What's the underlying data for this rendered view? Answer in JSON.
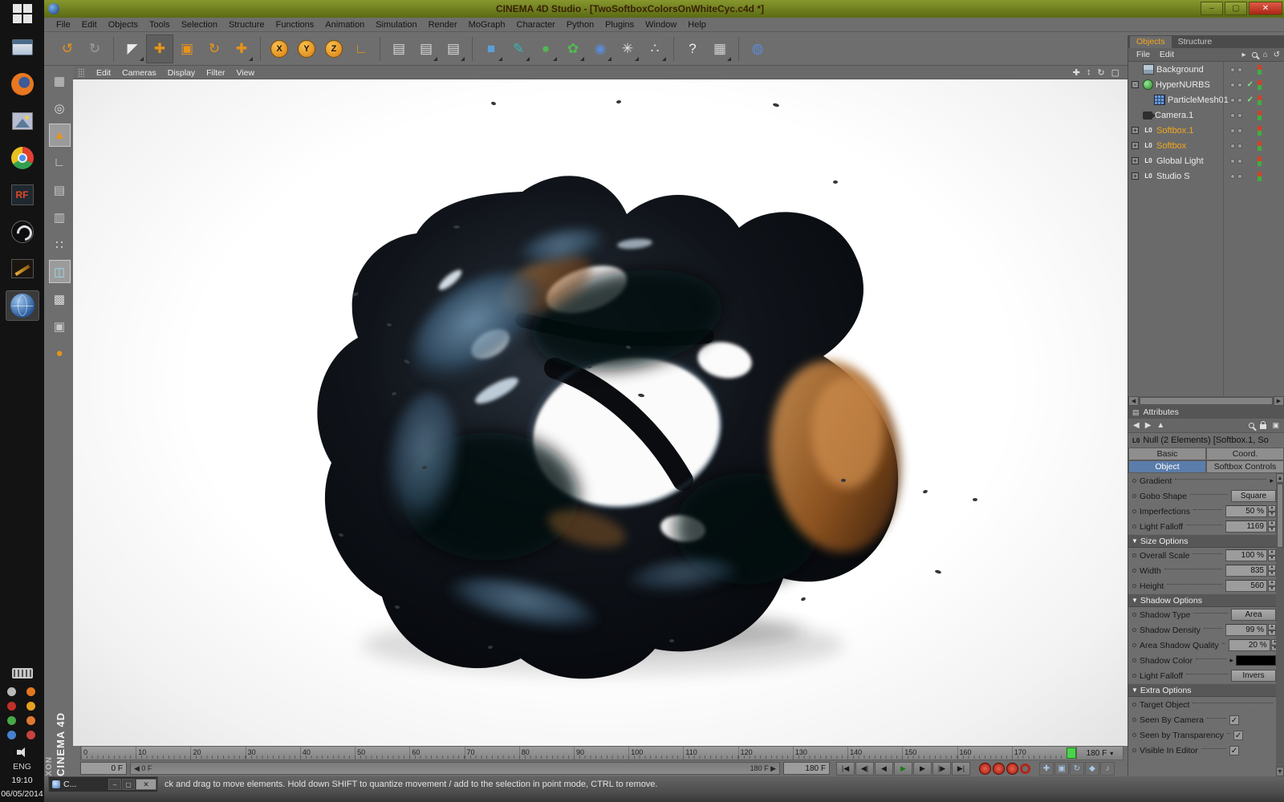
{
  "window": {
    "title": "CINEMA 4D Studio - [TwoSoftboxColorsOnWhiteCyc.c4d *]",
    "controls": {
      "minimize": "–",
      "maximize": "▢",
      "close": "✕"
    }
  },
  "taskbar": {
    "language": "ENG",
    "time": "19:10",
    "date": "06/05/2014",
    "apps": [
      {
        "name": "file-explorer-icon"
      },
      {
        "name": "firefox-icon"
      },
      {
        "name": "image-viewer-icon"
      },
      {
        "name": "chrome-icon"
      },
      {
        "name": "rf-app-icon",
        "label": "RF"
      },
      {
        "name": "obs-studio-icon"
      },
      {
        "name": "paint-app-icon"
      },
      {
        "name": "globe-app-icon",
        "active": true
      }
    ],
    "tray": [
      {
        "name": "tray-icon-1",
        "color": "#b8b8b8"
      },
      {
        "name": "tray-icon-2",
        "color": "#e07820"
      },
      {
        "name": "tray-icon-3",
        "color": "#c03028"
      },
      {
        "name": "tray-icon-4",
        "color": "#e8a020"
      },
      {
        "name": "tray-icon-5",
        "color": "#48a848"
      },
      {
        "name": "tray-icon-6",
        "color": "#e07830"
      },
      {
        "name": "tray-icon-7",
        "color": "#4880d0"
      },
      {
        "name": "tray-icon-8",
        "color": "#c84040"
      }
    ]
  },
  "menubar": {
    "items": [
      "File",
      "Edit",
      "Objects",
      "Tools",
      "Selection",
      "Structure",
      "Functions",
      "Animation",
      "Simulation",
      "Render",
      "MoGraph",
      "Character",
      "Python",
      "Plugins",
      "Window",
      "Help"
    ]
  },
  "toolbar": {
    "buttons": [
      {
        "name": "undo-button",
        "glyph": "↺",
        "color": "#e8941a"
      },
      {
        "name": "redo-button",
        "glyph": "↻",
        "color": "#9d9d9d"
      },
      {
        "name": "live-selection-tool",
        "glyph": "◤",
        "color": "#ececec",
        "sep": true,
        "corner": true
      },
      {
        "name": "move-tool",
        "glyph": "✚",
        "color": "#e8941a",
        "active": true
      },
      {
        "name": "scale-tool",
        "glyph": "▣",
        "color": "#e8941a"
      },
      {
        "name": "rotate-tool",
        "glyph": "↻",
        "color": "#e8941a"
      },
      {
        "name": "last-used-tool",
        "glyph": "✚",
        "color": "#e8941a",
        "corner": true
      },
      {
        "name": "x-axis-lock",
        "letter": "X",
        "sep": true
      },
      {
        "name": "y-axis-lock",
        "letter": "Y"
      },
      {
        "name": "z-axis-lock",
        "letter": "Z"
      },
      {
        "name": "coordinate-system-toggle",
        "glyph": "∟",
        "color": "#e8941a"
      },
      {
        "name": "render-view-button",
        "glyph": "▤",
        "color": "#d8d8d8",
        "sep": true
      },
      {
        "name": "render-picture-viewer-button",
        "glyph": "▤",
        "color": "#d8d8d8",
        "corner": true
      },
      {
        "name": "render-settings-button",
        "glyph": "▤",
        "color": "#d8d8d8",
        "corner": true
      },
      {
        "name": "add-cube-button",
        "glyph": "■",
        "color": "#5aa0d8",
        "sep": true,
        "corner": true
      },
      {
        "name": "add-spline-button",
        "glyph": "✎",
        "color": "#3ab4b4",
        "corner": true
      },
      {
        "name": "add-subdivision-button",
        "glyph": "●",
        "color": "#52b852",
        "corner": true
      },
      {
        "name": "add-array-button",
        "glyph": "✿",
        "color": "#52b852",
        "corner": true
      },
      {
        "name": "add-metaball-button",
        "glyph": "◉",
        "color": "#5a8ad8",
        "corner": true
      },
      {
        "name": "add-particles-button",
        "glyph": "✳",
        "color": "#e4e4e4",
        "corner": true
      },
      {
        "name": "add-physics-button",
        "glyph": "∴",
        "color": "#e4e4e4",
        "corner": true
      },
      {
        "name": "help-button",
        "glyph": "?",
        "color": "#ececec",
        "sep": true
      },
      {
        "name": "snap-settings-button",
        "glyph": "▦",
        "color": "#d0d0d0",
        "corner": true
      },
      {
        "name": "online-help-button",
        "glyph": "◍",
        "color": "#5a8ad8",
        "sep": true
      }
    ]
  },
  "palette": {
    "buttons": [
      {
        "name": "make-editable-button",
        "glyph": "▦",
        "color": "#cfcfcf"
      },
      {
        "name": "model-mode-button",
        "glyph": "◎",
        "color": "#dcdcdc"
      },
      {
        "name": "texture-mode-button",
        "glyph": "▲",
        "color": "#e8941a",
        "active": true
      },
      {
        "name": "axis-mode-button",
        "glyph": "∟",
        "color": "#dcdcdc"
      },
      {
        "name": "uv-mode-button",
        "glyph": "▤",
        "color": "#c8c8c8"
      },
      {
        "name": "workplane-mode-button",
        "glyph": "▥",
        "color": "#c8c8c8"
      },
      {
        "name": "points-mode-button",
        "glyph": "∷",
        "color": "#dcdcdc"
      },
      {
        "name": "edges-mode-button",
        "glyph": "◫",
        "color": "#9ad8e8",
        "active": true
      },
      {
        "name": "polygons-mode-button",
        "glyph": "▩",
        "color": "#dcdcdc"
      },
      {
        "name": "snap-mode-button",
        "glyph": "▣",
        "color": "#c8c8c8"
      },
      {
        "name": "viewport-filter-button",
        "glyph": "●",
        "color": "#e8941a"
      }
    ]
  },
  "viewport": {
    "menu": [
      "Edit",
      "Cameras",
      "Display",
      "Filter",
      "View"
    ],
    "nav": [
      {
        "name": "pan-view-icon",
        "glyph": "✚"
      },
      {
        "name": "zoom-view-icon",
        "glyph": "↕"
      },
      {
        "name": "rotate-view-icon",
        "glyph": "↻"
      },
      {
        "name": "toggle-view-icon",
        "glyph": "▢"
      }
    ]
  },
  "objects_panel": {
    "tabs": [
      {
        "label": "Objects"
      },
      {
        "label": "Structure"
      }
    ],
    "menu": [
      "File",
      "Edit"
    ],
    "header_icons": [
      {
        "name": "expand-arrow-icon",
        "glyph": "▸"
      },
      {
        "name": "search-icon",
        "css": "mini-mag"
      },
      {
        "name": "home-icon",
        "glyph": "⌂"
      },
      {
        "name": "refresh-icon",
        "glyph": "↺"
      }
    ],
    "items": [
      {
        "name": "Background",
        "icon": "background-icon",
        "indent": 0
      },
      {
        "name": "HyperNURBS",
        "icon": "hypernurbs-icon",
        "indent": 0,
        "expander": "-",
        "check": true
      },
      {
        "name": "ParticleMesh01",
        "icon": "mesh-icon",
        "indent": 1,
        "check": true
      },
      {
        "name": "Camera.1",
        "icon": "camera-icon",
        "indent": 0
      },
      {
        "name": "Softbox.1",
        "icon": "null-object-icon",
        "indent": 0,
        "expander": "+",
        "selected": true
      },
      {
        "name": "Softbox",
        "icon": "null-object-icon",
        "indent": 0,
        "expander": "+",
        "selected": true
      },
      {
        "name": "Global Light",
        "icon": "null-object-icon",
        "indent": 0,
        "expander": "+"
      },
      {
        "name": "Studio S",
        "icon": "null-object-icon",
        "indent": 0,
        "expander": "+"
      }
    ]
  },
  "attributes_panel": {
    "header": "Attributes",
    "object_title": "Null (2 Elements) [Softbox.1, So",
    "nav": [
      {
        "name": "back-icon",
        "glyph": "◀"
      },
      {
        "name": "forward-icon",
        "glyph": "▶"
      },
      {
        "name": "up-icon",
        "glyph": "▲"
      }
    ],
    "tabs": [
      {
        "label": "Basic"
      },
      {
        "label": "Coord."
      },
      {
        "label": "Object",
        "active": true
      },
      {
        "label": "Softbox Controls"
      }
    ],
    "rows": [
      {
        "type": "collapsed",
        "label": "Gradient"
      },
      {
        "type": "button",
        "label": "Gobo Shape",
        "value": "Square"
      },
      {
        "type": "stepper",
        "label": "Imperfections",
        "value": "50 %"
      },
      {
        "type": "stepper",
        "label": "Light Falloff",
        "value": "1169"
      },
      {
        "type": "section",
        "label": "Size Options"
      },
      {
        "type": "stepper",
        "label": "Overall Scale",
        "value": "100 %"
      },
      {
        "type": "stepper",
        "label": "Width",
        "value": "835"
      },
      {
        "type": "stepper",
        "label": "Height",
        "value": "560"
      },
      {
        "type": "section",
        "label": "Shadow Options"
      },
      {
        "type": "button",
        "label": "Shadow Type",
        "value": "Area"
      },
      {
        "type": "stepper",
        "label": "Shadow Density",
        "value": "99 %"
      },
      {
        "type": "stepper",
        "label": "Area Shadow Quality",
        "value": "20 %"
      },
      {
        "type": "color",
        "label": "Shadow Color",
        "value": "#000000"
      },
      {
        "type": "button",
        "label": "Light Falloff",
        "value": "Invers"
      },
      {
        "type": "section",
        "label": "Extra Options"
      },
      {
        "type": "plain",
        "label": "Target Object"
      },
      {
        "type": "check",
        "label": "Seen By Camera",
        "checked": true
      },
      {
        "type": "check",
        "label": "Seen by Transparency",
        "checked": true
      },
      {
        "type": "check",
        "label": "Visible In Editor",
        "checked": true
      }
    ]
  },
  "timeline": {
    "ticks": [
      "0",
      "10",
      "20",
      "30",
      "40",
      "50",
      "60",
      "70",
      "80",
      "90",
      "100",
      "110",
      "120",
      "130",
      "140",
      "150",
      "160",
      "170"
    ],
    "ruler_end": "180 F",
    "current_frame": "0 F",
    "range_start": "◀ 0 F",
    "range_end": "180 F ▶",
    "end_frame": "180 F"
  },
  "transport": {
    "buttons": [
      {
        "name": "goto-start-button",
        "glyph": "|◀"
      },
      {
        "name": "previous-key-button",
        "glyph": "◀|"
      },
      {
        "name": "previous-frame-button",
        "glyph": "◀"
      },
      {
        "name": "play-button",
        "glyph": "▶",
        "accent": "#1c7a1c"
      },
      {
        "name": "next-frame-button",
        "glyph": "▶"
      },
      {
        "name": "next-key-button",
        "glyph": "|▶"
      },
      {
        "name": "goto-end-button",
        "glyph": "▶|"
      }
    ],
    "record_buttons": [
      {
        "name": "record-keyframe-button",
        "style": "solid"
      },
      {
        "name": "record-position-toggle",
        "style": "solid"
      },
      {
        "name": "record-rotation-toggle",
        "style": "solid"
      },
      {
        "name": "autokey-toggle",
        "style": "ring"
      }
    ],
    "option_buttons": [
      {
        "name": "keyframe-position-toggle",
        "glyph": "✚"
      },
      {
        "name": "keyframe-scale-toggle",
        "glyph": "▣"
      },
      {
        "name": "keyframe-rotation-toggle",
        "glyph": "↻"
      },
      {
        "name": "keyframe-parameter-toggle",
        "glyph": "◆"
      },
      {
        "name": "keyframe-pla-toggle",
        "glyph": "♪"
      }
    ]
  },
  "statusbar": {
    "text": "ck and drag to move elements. Hold down SHIFT to quantize movement / add to the selection in point mode, CTRL to remove."
  },
  "mini_window": {
    "title": "C...",
    "minimize": "–",
    "maximize": "▢",
    "close": "✕"
  },
  "brand": {
    "maxon": "XON",
    "cinema": "CINEMA 4D"
  }
}
